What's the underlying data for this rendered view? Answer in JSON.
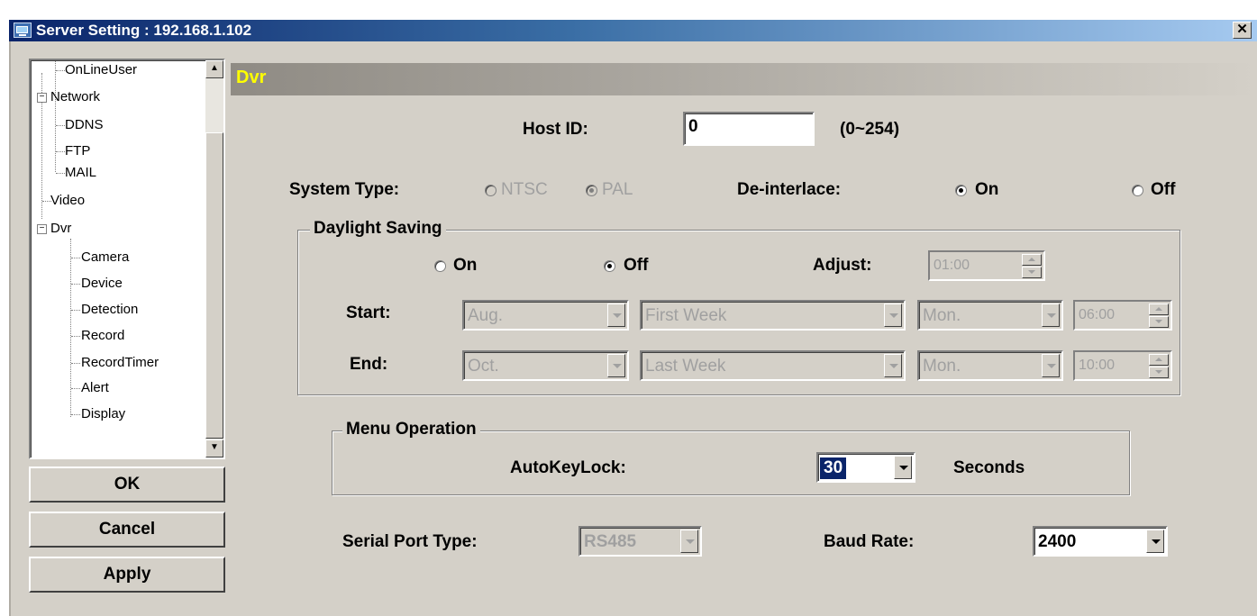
{
  "window": {
    "title": "Server Setting : 192.168.1.102",
    "close_glyph": "✕"
  },
  "tree": {
    "items": [
      {
        "label": "OnLineUser"
      },
      {
        "label": "Network"
      },
      {
        "label": "DDNS"
      },
      {
        "label": "FTP"
      },
      {
        "label": "MAIL"
      },
      {
        "label": "Video"
      },
      {
        "label": "Dvr"
      },
      {
        "label": "Camera"
      },
      {
        "label": "Device"
      },
      {
        "label": "Detection"
      },
      {
        "label": "Record"
      },
      {
        "label": "RecordTimer"
      },
      {
        "label": "Alert"
      },
      {
        "label": "Display"
      }
    ],
    "collapse_glyph": "−"
  },
  "buttons": {
    "ok": "OK",
    "cancel": "Cancel",
    "apply": "Apply"
  },
  "header": {
    "title": "Dvr"
  },
  "host": {
    "label": "Host ID:",
    "value": "0",
    "range": "(0~254)"
  },
  "system_type": {
    "label": "System Type:",
    "ntsc": "NTSC",
    "pal": "PAL",
    "selected": "PAL"
  },
  "deinterlace": {
    "label": "De-interlace:",
    "on": "On",
    "off": "Off",
    "selected": "On"
  },
  "daylight": {
    "title": "Daylight Saving",
    "on": "On",
    "off": "Off",
    "selected": "Off",
    "adjust_label": "Adjust:",
    "adjust_value": "01:00",
    "start_label": "Start:",
    "start_month": "Aug.",
    "start_week": "First Week",
    "start_day": "Mon.",
    "start_time": "06:00",
    "end_label": "End:",
    "end_month": "Oct.",
    "end_week": "Last Week",
    "end_day": "Mon.",
    "end_time": "10:00"
  },
  "menu_op": {
    "title": "Menu Operation",
    "label": "AutoKeyLock:",
    "value": "30",
    "unit": "Seconds"
  },
  "serial": {
    "label": "Serial Port Type:",
    "value": "RS485"
  },
  "baud": {
    "label": "Baud Rate:",
    "value": "2400"
  },
  "icons": {
    "scroll_up": "▲",
    "scroll_down": "▼"
  }
}
